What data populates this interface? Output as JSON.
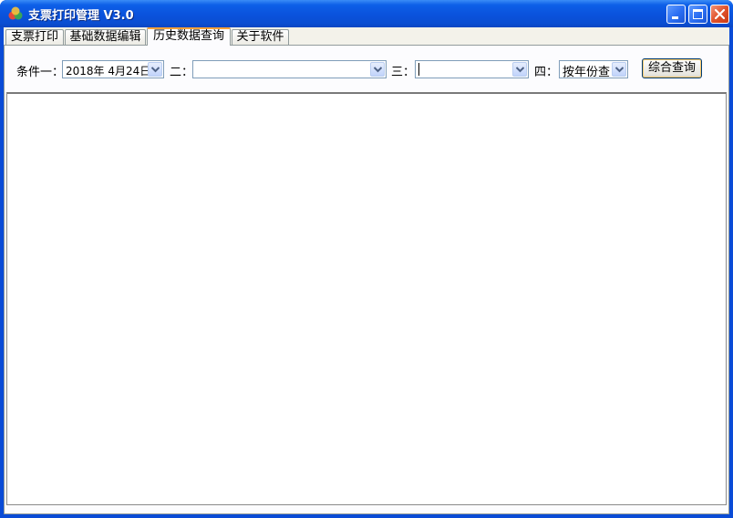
{
  "window": {
    "title": "支票打印管理 V3.0",
    "icons": {
      "app": "app-icon",
      "minimize": "minimize-icon",
      "maximize": "maximize-icon",
      "close": "close-icon"
    },
    "colors": {
      "titlebar": "#0a52dc",
      "client": "#f3f2ea",
      "active_tab_accent": "#f7a23a"
    }
  },
  "tabs": [
    {
      "label": "支票打印",
      "active": false
    },
    {
      "label": "基础数据编辑",
      "active": false
    },
    {
      "label": "历史数据查询",
      "active": true
    },
    {
      "label": "关于软件",
      "active": false
    }
  ],
  "query": {
    "condition1": {
      "label": "条件一：",
      "value": "2018年  4月24日"
    },
    "condition2": {
      "label": "二：",
      "value": ""
    },
    "condition3": {
      "label": "三：",
      "value": ""
    },
    "condition4": {
      "label": "四：",
      "value": "按年份查"
    },
    "submit_label": "综合查询",
    "dropdown_icon": "chevron-down-icon"
  },
  "results": {
    "rows": []
  }
}
